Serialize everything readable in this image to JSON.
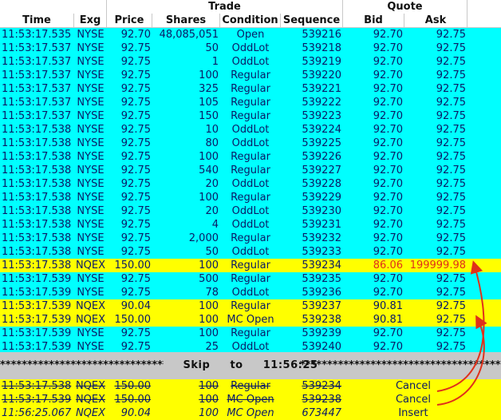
{
  "header": {
    "group_trade": "Trade",
    "group_quote": "Quote",
    "columns": [
      "Time",
      "Exg",
      "Price",
      "Shares",
      "Condition",
      "Sequence",
      "Bid",
      "Ask"
    ]
  },
  "rows": [
    {
      "time": "11:53:17.535",
      "exg": "NYSE",
      "price": "92.70",
      "shares": "48,085,051",
      "cond": "Open",
      "seq": "539216",
      "bid": "92.70",
      "ask": "92.75",
      "style": "cyan"
    },
    {
      "time": "11:53:17.537",
      "exg": "NYSE",
      "price": "92.75",
      "shares": "50",
      "cond": "OddLot",
      "seq": "539218",
      "bid": "92.70",
      "ask": "92.75",
      "style": "cyan"
    },
    {
      "time": "11:53:17.537",
      "exg": "NYSE",
      "price": "92.75",
      "shares": "1",
      "cond": "OddLot",
      "seq": "539219",
      "bid": "92.70",
      "ask": "92.75",
      "style": "cyan"
    },
    {
      "time": "11:53:17.537",
      "exg": "NYSE",
      "price": "92.75",
      "shares": "100",
      "cond": "Regular",
      "seq": "539220",
      "bid": "92.70",
      "ask": "92.75",
      "style": "cyan"
    },
    {
      "time": "11:53:17.537",
      "exg": "NYSE",
      "price": "92.75",
      "shares": "325",
      "cond": "Regular",
      "seq": "539221",
      "bid": "92.70",
      "ask": "92.75",
      "style": "cyan"
    },
    {
      "time": "11:53:17.537",
      "exg": "NYSE",
      "price": "92.75",
      "shares": "105",
      "cond": "Regular",
      "seq": "539222",
      "bid": "92.70",
      "ask": "92.75",
      "style": "cyan"
    },
    {
      "time": "11:53:17.537",
      "exg": "NYSE",
      "price": "92.75",
      "shares": "150",
      "cond": "Regular",
      "seq": "539223",
      "bid": "92.70",
      "ask": "92.75",
      "style": "cyan"
    },
    {
      "time": "11:53:17.538",
      "exg": "NYSE",
      "price": "92.75",
      "shares": "10",
      "cond": "OddLot",
      "seq": "539224",
      "bid": "92.70",
      "ask": "92.75",
      "style": "cyan"
    },
    {
      "time": "11:53:17.538",
      "exg": "NYSE",
      "price": "92.75",
      "shares": "80",
      "cond": "OddLot",
      "seq": "539225",
      "bid": "92.70",
      "ask": "92.75",
      "style": "cyan"
    },
    {
      "time": "11:53:17.538",
      "exg": "NYSE",
      "price": "92.75",
      "shares": "100",
      "cond": "Regular",
      "seq": "539226",
      "bid": "92.70",
      "ask": "92.75",
      "style": "cyan"
    },
    {
      "time": "11:53:17.538",
      "exg": "NYSE",
      "price": "92.75",
      "shares": "540",
      "cond": "Regular",
      "seq": "539227",
      "bid": "92.70",
      "ask": "92.75",
      "style": "cyan"
    },
    {
      "time": "11:53:17.538",
      "exg": "NYSE",
      "price": "92.75",
      "shares": "20",
      "cond": "OddLot",
      "seq": "539228",
      "bid": "92.70",
      "ask": "92.75",
      "style": "cyan"
    },
    {
      "time": "11:53:17.538",
      "exg": "NYSE",
      "price": "92.75",
      "shares": "100",
      "cond": "Regular",
      "seq": "539229",
      "bid": "92.70",
      "ask": "92.75",
      "style": "cyan"
    },
    {
      "time": "11:53:17.538",
      "exg": "NYSE",
      "price": "92.75",
      "shares": "20",
      "cond": "OddLot",
      "seq": "539230",
      "bid": "92.70",
      "ask": "92.75",
      "style": "cyan"
    },
    {
      "time": "11:53:17.538",
      "exg": "NYSE",
      "price": "92.75",
      "shares": "4",
      "cond": "OddLot",
      "seq": "539231",
      "bid": "92.70",
      "ask": "92.75",
      "style": "cyan"
    },
    {
      "time": "11:53:17.538",
      "exg": "NYSE",
      "price": "92.75",
      "shares": "2,000",
      "cond": "Regular",
      "seq": "539232",
      "bid": "92.70",
      "ask": "92.75",
      "style": "cyan"
    },
    {
      "time": "11:53:17.538",
      "exg": "NYSE",
      "price": "92.75",
      "shares": "50",
      "cond": "OddLot",
      "seq": "539233",
      "bid": "92.70",
      "ask": "92.75",
      "style": "cyan"
    },
    {
      "time": "11:53:17.538",
      "exg": "NQEX",
      "price": "150.00",
      "shares": "100",
      "cond": "Regular",
      "seq": "539234",
      "bid": "86.06",
      "ask": "199999.98",
      "style": "yellow",
      "quote_red": true
    },
    {
      "time": "11:53:17.539",
      "exg": "NYSE",
      "price": "92.75",
      "shares": "500",
      "cond": "Regular",
      "seq": "539235",
      "bid": "92.70",
      "ask": "92.75",
      "style": "cyan"
    },
    {
      "time": "11:53:17.539",
      "exg": "NYSE",
      "price": "92.75",
      "shares": "78",
      "cond": "OddLot",
      "seq": "539236",
      "bid": "92.70",
      "ask": "92.75",
      "style": "cyan"
    },
    {
      "time": "11:53:17.539",
      "exg": "NQEX",
      "price": "90.04",
      "shares": "100",
      "cond": "Regular",
      "seq": "539237",
      "bid": "90.81",
      "ask": "92.75",
      "style": "yellow"
    },
    {
      "time": "11:53:17.539",
      "exg": "NQEX",
      "price": "150.00",
      "shares": "100",
      "cond": "MC Open",
      "seq": "539238",
      "bid": "90.81",
      "ask": "92.75",
      "style": "yellow"
    },
    {
      "time": "11:53:17.539",
      "exg": "NYSE",
      "price": "92.75",
      "shares": "100",
      "cond": "Regular",
      "seq": "539239",
      "bid": "92.70",
      "ask": "92.75",
      "style": "cyan"
    },
    {
      "time": "11:53:17.539",
      "exg": "NYSE",
      "price": "92.75",
      "shares": "25",
      "cond": "OddLot",
      "seq": "539240",
      "bid": "92.70",
      "ask": "92.75",
      "style": "cyan"
    }
  ],
  "skip": {
    "label": "Skip",
    "to": "to",
    "time": "11:56:25"
  },
  "corrections": [
    {
      "time": "11:53:17.538",
      "exg": "NQEX",
      "price": "150.00",
      "shares": "100",
      "cond": "Regular",
      "seq": "539234",
      "action": "Cancel",
      "style": "strike"
    },
    {
      "time": "11:53:17.539",
      "exg": "NQEX",
      "price": "150.00",
      "shares": "100",
      "cond": "MC Open",
      "seq": "539238",
      "action": "Cancel",
      "style": "strike"
    },
    {
      "time": "11:56:25.067",
      "exg": "NQEX",
      "price": "90.04",
      "shares": "100",
      "cond": "MC Open",
      "seq": "673447",
      "action": "Insert",
      "style": "italic"
    }
  ],
  "colors": {
    "cyan_row": "#00ffff",
    "yellow_row": "#ffff00",
    "text": "#0a1a66",
    "alert_red": "#e0301a",
    "arrow_red": "#e0301a",
    "skip_bar": "#c8c8c8"
  }
}
